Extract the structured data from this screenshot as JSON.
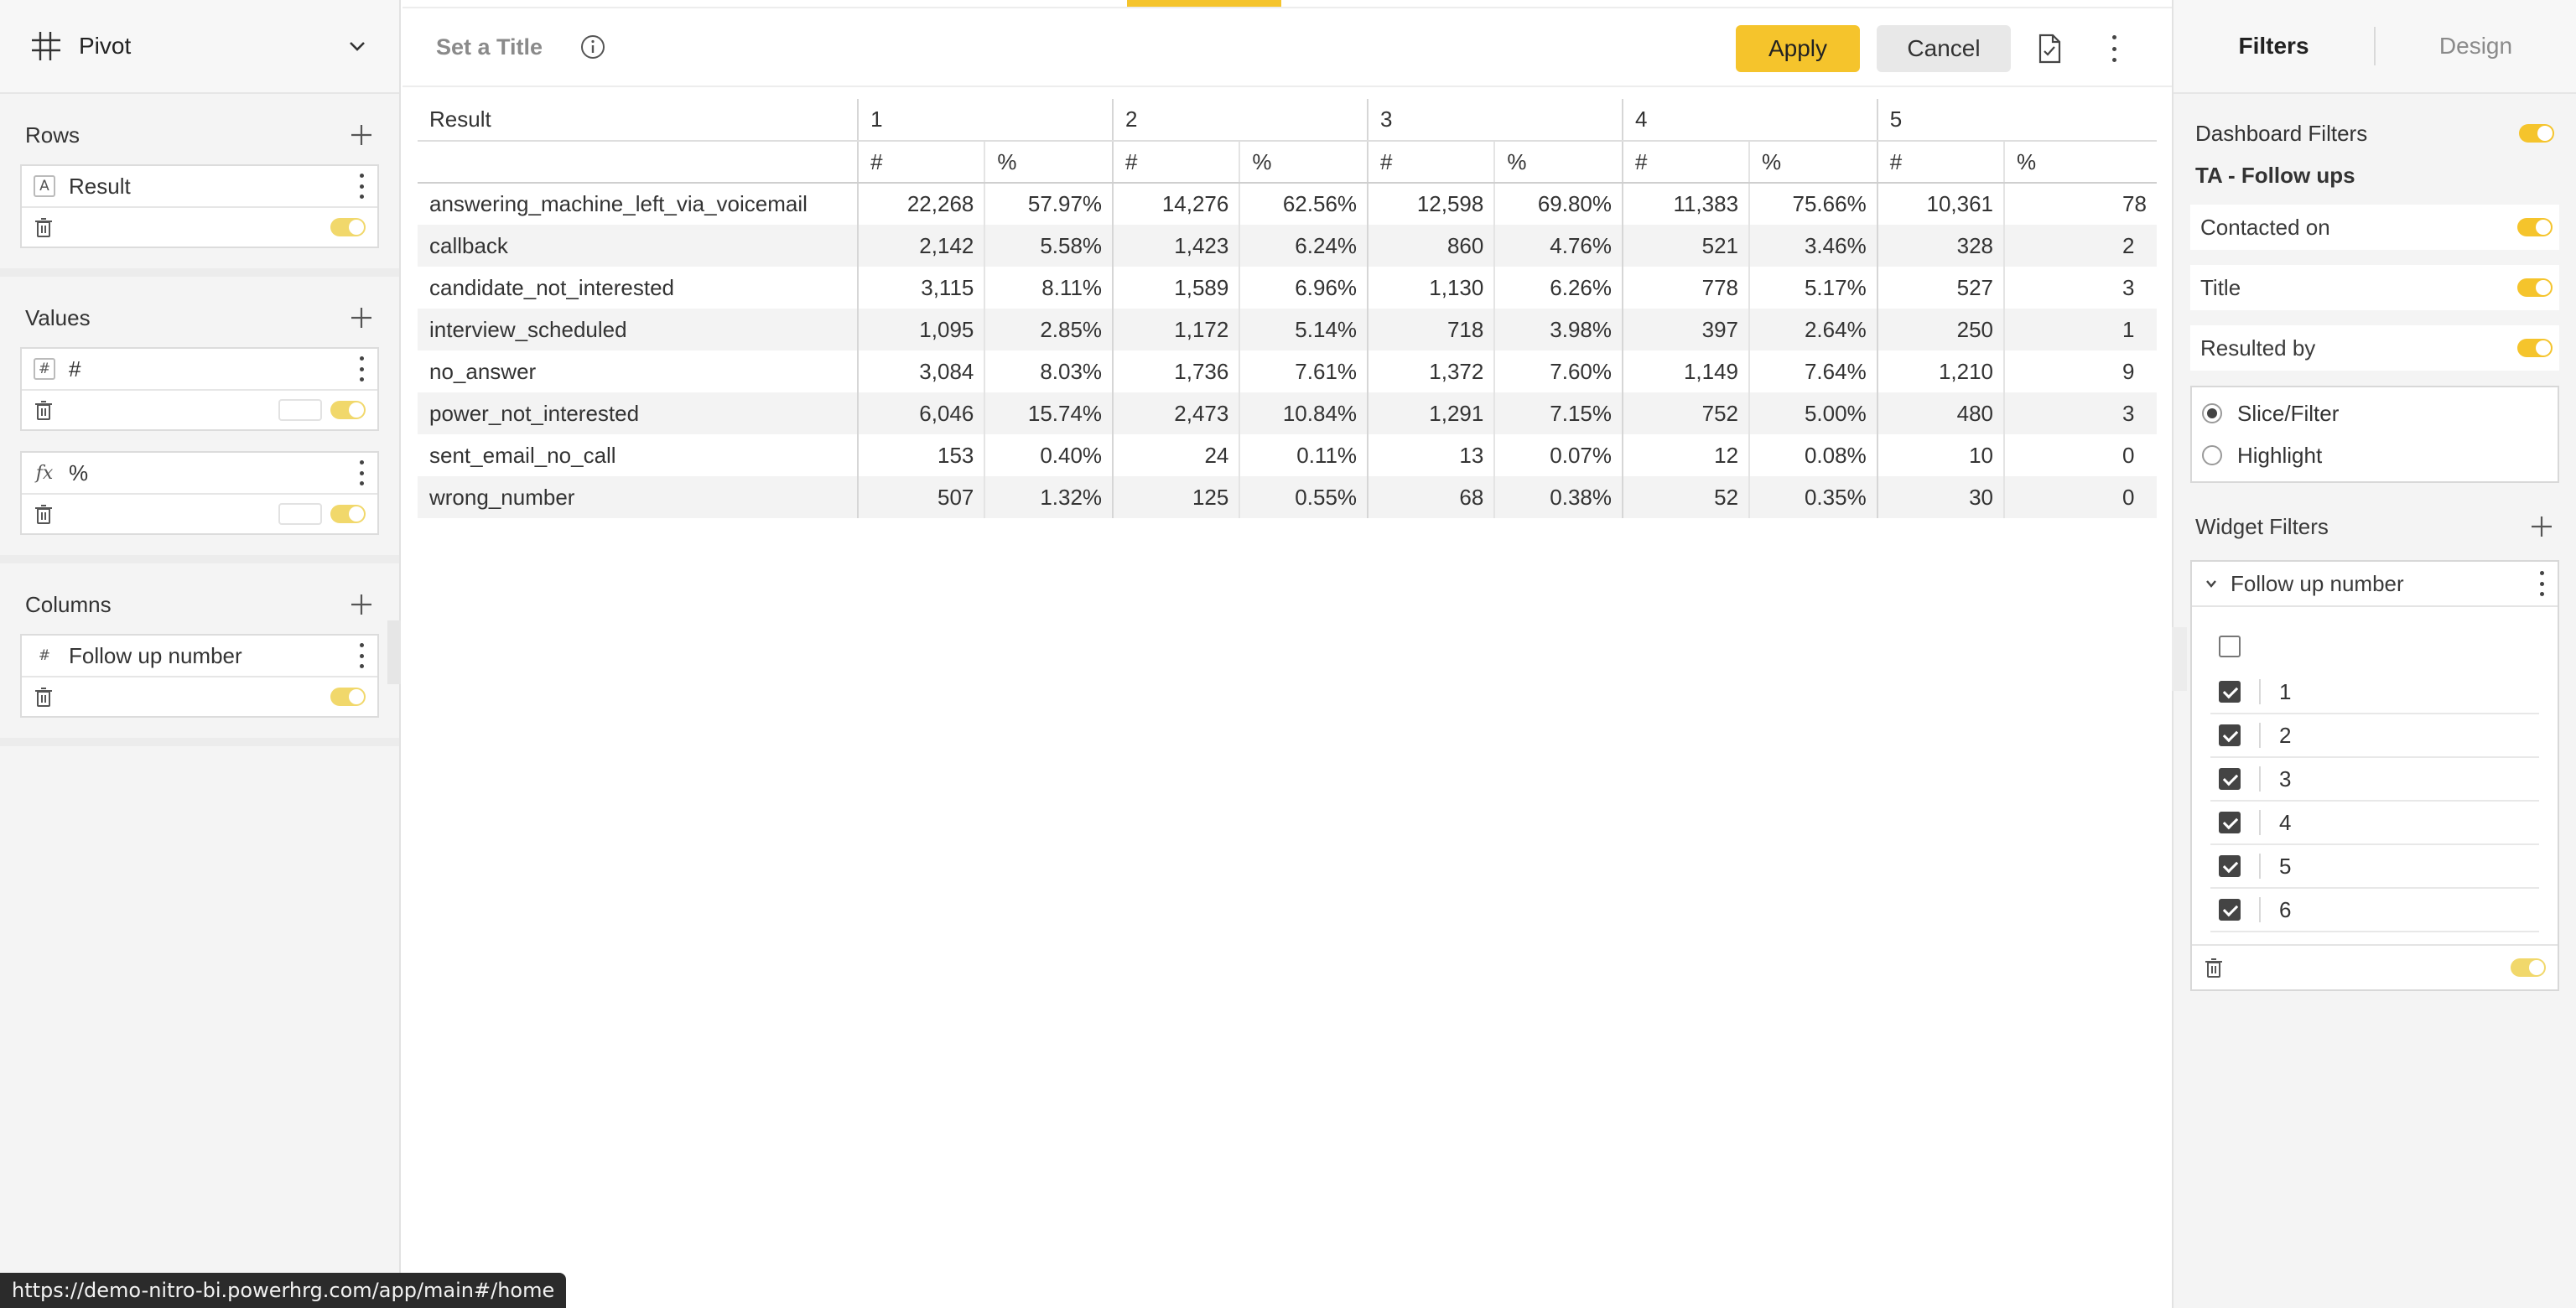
{
  "left_panel": {
    "widget_type": "Pivot",
    "rows": {
      "title": "Rows",
      "field": {
        "type": "A",
        "name": "Result"
      }
    },
    "values": {
      "title": "Values",
      "fields": [
        {
          "type": "#",
          "name": "#"
        },
        {
          "type": "fx",
          "name": "%"
        }
      ]
    },
    "columns": {
      "title": "Columns",
      "field": {
        "type": "#",
        "name": "Follow up number"
      }
    }
  },
  "toolbar": {
    "title_placeholder": "Set a Title",
    "apply_label": "Apply",
    "cancel_label": "Cancel"
  },
  "pivot": {
    "row_header": "Result",
    "column_groups": [
      "1",
      "2",
      "3",
      "4",
      "5"
    ],
    "sub_headers": [
      "#",
      "%"
    ],
    "last_partial_values": [
      "78",
      "2",
      "3",
      "1",
      "9",
      "3",
      "0",
      "0"
    ],
    "rows": [
      {
        "label": "answering_machine_left_via_voicemail",
        "values": [
          "22,268",
          "57.97%",
          "14,276",
          "62.56%",
          "12,598",
          "69.80%",
          "11,383",
          "75.66%",
          "10,361"
        ]
      },
      {
        "label": "callback",
        "values": [
          "2,142",
          "5.58%",
          "1,423",
          "6.24%",
          "860",
          "4.76%",
          "521",
          "3.46%",
          "328"
        ]
      },
      {
        "label": "candidate_not_interested",
        "values": [
          "3,115",
          "8.11%",
          "1,589",
          "6.96%",
          "1,130",
          "6.26%",
          "778",
          "5.17%",
          "527"
        ]
      },
      {
        "label": "interview_scheduled",
        "values": [
          "1,095",
          "2.85%",
          "1,172",
          "5.14%",
          "718",
          "3.98%",
          "397",
          "2.64%",
          "250"
        ]
      },
      {
        "label": "no_answer",
        "values": [
          "3,084",
          "8.03%",
          "1,736",
          "7.61%",
          "1,372",
          "7.60%",
          "1,149",
          "7.64%",
          "1,210"
        ]
      },
      {
        "label": "power_not_interested",
        "values": [
          "6,046",
          "15.74%",
          "2,473",
          "10.84%",
          "1,291",
          "7.15%",
          "752",
          "5.00%",
          "480"
        ]
      },
      {
        "label": "sent_email_no_call",
        "values": [
          "153",
          "0.40%",
          "24",
          "0.11%",
          "13",
          "0.07%",
          "12",
          "0.08%",
          "10"
        ]
      },
      {
        "label": "wrong_number",
        "values": [
          "507",
          "1.32%",
          "125",
          "0.55%",
          "68",
          "0.38%",
          "52",
          "0.35%",
          "30"
        ]
      }
    ]
  },
  "right_panel": {
    "tabs": [
      "Filters",
      "Design"
    ],
    "dashboard_filters_label": "Dashboard Filters",
    "dashboard_name": "TA - Follow ups",
    "filters": [
      "Contacted on",
      "Title",
      "Resulted by"
    ],
    "modes": [
      {
        "label": "Slice/Filter",
        "selected": true
      },
      {
        "label": "Highlight",
        "selected": false
      }
    ],
    "widget_filters_label": "Widget Filters",
    "widget_filter": {
      "name": "Follow up number",
      "options": [
        {
          "label": "1",
          "checked": true
        },
        {
          "label": "2",
          "checked": true
        },
        {
          "label": "3",
          "checked": true
        },
        {
          "label": "4",
          "checked": true
        },
        {
          "label": "5",
          "checked": true
        },
        {
          "label": "6",
          "checked": true
        }
      ]
    }
  },
  "status_bar": {
    "url": "https://demo-nitro-bi.powerhrg.com/app/main#/home"
  },
  "colors": {
    "accent": "#f5c42c",
    "panel_bg": "#f4f4f4"
  }
}
